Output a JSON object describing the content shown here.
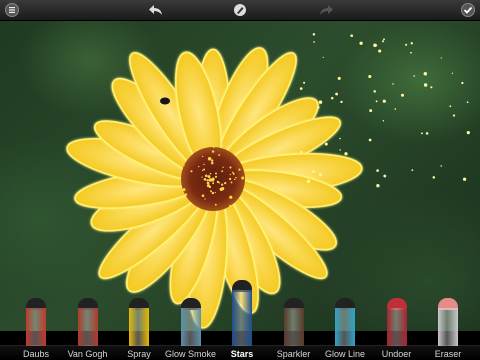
{
  "topbar": {
    "menu_icon": "menu-icon",
    "undo_icon": "undo-arrow-icon",
    "center_icon": "brush-picker-icon",
    "redo_icon": "redo-arrow-icon",
    "done_icon": "checkmark-icon"
  },
  "canvas": {
    "subject": "yellow flower photo with glowing Stars brush strokes"
  },
  "brushes": [
    {
      "label": "Daubs",
      "color": "#c0392b",
      "active": false
    },
    {
      "label": "Van Gogh",
      "color": "#b03a2e",
      "active": false
    },
    {
      "label": "Spray",
      "color": "#e6b800",
      "active": false
    },
    {
      "label": "Glow Smoke",
      "color": "#5b8fa8",
      "active": false
    },
    {
      "label": "Stars",
      "color": "#1f4e8c",
      "active": true
    },
    {
      "label": "Sparkler",
      "color": "#5a3a2a",
      "active": false
    },
    {
      "label": "Glow Line",
      "color": "#2fa3c9",
      "active": false
    },
    {
      "label": "Undoer",
      "color": "#a8232e",
      "active": false
    },
    {
      "label": "Eraser",
      "color": "#c8c8c8",
      "active": false
    }
  ]
}
